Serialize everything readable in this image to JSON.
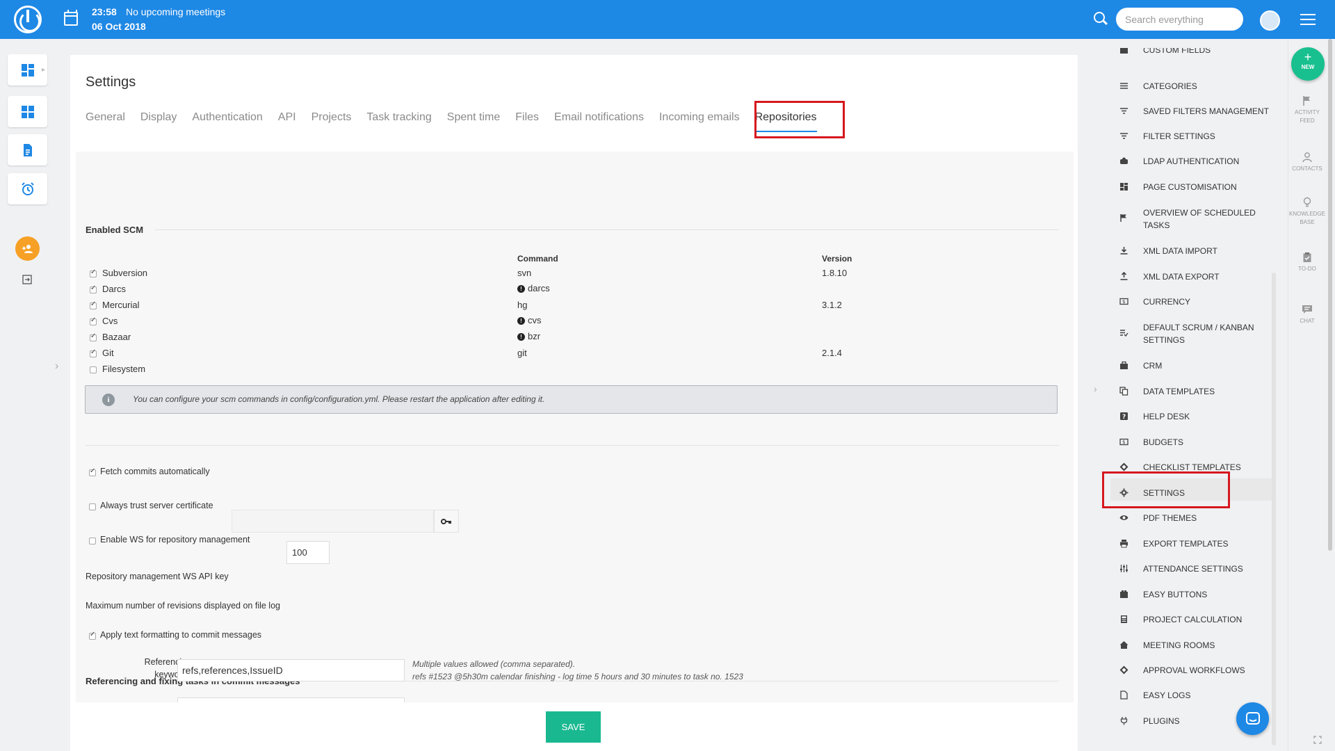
{
  "topbar": {
    "time": "23:58",
    "meeting_status": "No upcoming meetings",
    "date": "06 Oct 2018",
    "search_placeholder": "Search everything"
  },
  "page": {
    "title": "Settings",
    "tabs": [
      "General",
      "Display",
      "Authentication",
      "API",
      "Projects",
      "Task tracking",
      "Spent time",
      "Files",
      "Email notifications",
      "Incoming emails",
      "Repositories"
    ],
    "active_tab": "Repositories"
  },
  "scm": {
    "heading": "Enabled SCM",
    "col_command": "Command",
    "col_version": "Version",
    "rows": [
      {
        "name": "Subversion",
        "enabled": true,
        "command": "svn",
        "version": "1.8.10",
        "warning": false
      },
      {
        "name": "Darcs",
        "enabled": true,
        "command": "darcs",
        "version": "",
        "warning": true
      },
      {
        "name": "Mercurial",
        "enabled": true,
        "command": "hg",
        "version": "3.1.2",
        "warning": false
      },
      {
        "name": "Cvs",
        "enabled": true,
        "command": "cvs",
        "version": "",
        "warning": true
      },
      {
        "name": "Bazaar",
        "enabled": true,
        "command": "bzr",
        "version": "",
        "warning": true
      },
      {
        "name": "Git",
        "enabled": true,
        "command": "git",
        "version": "2.1.4",
        "warning": false
      },
      {
        "name": "Filesystem",
        "enabled": false,
        "command": "",
        "version": "",
        "warning": false
      }
    ],
    "info": "You can configure your scm commands in config/configuration.yml. Please restart the application after editing it."
  },
  "options": {
    "fetch_commits": {
      "label": "Fetch commits automatically",
      "checked": true
    },
    "trust_cert": {
      "label": "Always trust server certificate",
      "checked": false
    },
    "enable_ws": {
      "label": "Enable WS for repository management",
      "checked": false
    },
    "ws_key_label": "Repository management WS API key",
    "max_revisions_label": "Maximum number of revisions displayed on file log",
    "max_revisions_value": "100",
    "text_formatting": {
      "label": "Apply text formatting to commit messages",
      "checked": true
    }
  },
  "referencing": {
    "heading": "Referencing and fixing tasks in commit messages",
    "keywords_label_1": "Referencing",
    "keywords_label_2": "keywords",
    "keywords_value": "refs,references,IssueID",
    "hint_1": "Multiple values allowed (comma separated).",
    "hint_2": "refs #1523 @5h30m calendar finishing - log time 5 hours and 30 minutes to task no. 1523"
  },
  "save_label": "SAVE",
  "admin_menu": [
    {
      "label": "CUSTOM FIELDS",
      "icon": "custom-fields-icon"
    },
    {
      "label": "CATEGORIES",
      "icon": "list-icon"
    },
    {
      "label": "SAVED FILTERS MANAGEMENT",
      "icon": "filter-icon"
    },
    {
      "label": "FILTER SETTINGS",
      "icon": "filter-icon"
    },
    {
      "label": "LDAP AUTHENTICATION",
      "icon": "ldap-icon"
    },
    {
      "label": "PAGE CUSTOMISATION",
      "icon": "dashboard-icon"
    },
    {
      "label": "OVERVIEW OF SCHEDULED",
      "label2": "TASKS",
      "icon": "flag-icon"
    },
    {
      "label": "XML DATA IMPORT",
      "icon": "download-icon"
    },
    {
      "label": "XML DATA EXPORT",
      "icon": "upload-icon"
    },
    {
      "label": "CURRENCY",
      "icon": "currency-icon"
    },
    {
      "label": "DEFAULT SCRUM / KANBAN",
      "label2": "SETTINGS",
      "icon": "checklist-icon"
    },
    {
      "label": "CRM",
      "icon": "briefcase-icon"
    },
    {
      "label": "DATA TEMPLATES",
      "icon": "copy-icon"
    },
    {
      "label": "HELP DESK",
      "icon": "help-icon"
    },
    {
      "label": "BUDGETS",
      "icon": "budget-icon"
    },
    {
      "label": "CHECKLIST TEMPLATES",
      "icon": "diamond-icon"
    },
    {
      "label": "SETTINGS",
      "icon": "gear-icon"
    },
    {
      "label": "PDF THEMES",
      "icon": "eye-icon"
    },
    {
      "label": "EXPORT TEMPLATES",
      "icon": "print-icon"
    },
    {
      "label": "ATTENDANCE SETTINGS",
      "icon": "sliders-icon"
    },
    {
      "label": "EASY BUTTONS",
      "icon": "buttons-icon"
    },
    {
      "label": "PROJECT CALCULATION",
      "icon": "calculator-icon"
    },
    {
      "label": "MEETING ROOMS",
      "icon": "home-icon"
    },
    {
      "label": "APPROVAL WORKFLOWS",
      "icon": "diamond-icon"
    },
    {
      "label": "EASY LOGS",
      "icon": "file-icon"
    },
    {
      "label": "PLUGINS",
      "icon": "plug-icon"
    }
  ],
  "rail": {
    "new_label": "NEW",
    "activity_1": "ACTIVITY",
    "activity_2": "FEED",
    "contacts": "CONTACTS",
    "kb_1": "KNOWLEDGE",
    "kb_2": "BASE",
    "todo": "TO-DO",
    "chat": "CHAT"
  },
  "colors": {
    "brand": "#1e88e5",
    "save": "#19b890",
    "highlight": "#d6181f",
    "add_user": "#f7a026"
  }
}
